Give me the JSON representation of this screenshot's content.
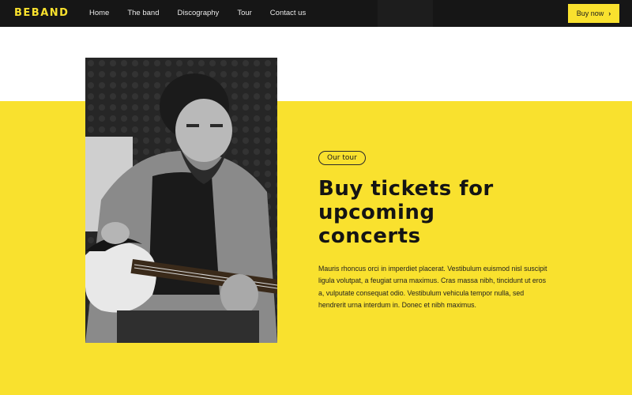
{
  "brand": {
    "logo": "BEBAND"
  },
  "nav": {
    "items": [
      {
        "label": "Home"
      },
      {
        "label": "The band"
      },
      {
        "label": "Discography"
      },
      {
        "label": "Tour"
      },
      {
        "label": "Contact us"
      }
    ],
    "cta_label": "Buy now",
    "cta_icon": "chevron-right-icon"
  },
  "hero": {
    "image_alt": "",
    "tag": "Our tour",
    "heading_line1": "Buy tickets for",
    "heading_line2": "upcoming",
    "heading_line3": "concerts",
    "body": "Mauris rhoncus orci in imperdiet placerat. Vestibulum euismod nisl suscipit ligula volutpat, a feugiat urna maximus. Cras massa nibh, tincidunt ut eros a, vulputate consequat odio. Vestibulum vehicula tempor nulla, sed hendrerit urna interdum in. Donec et nibh maximus."
  },
  "colors": {
    "accent": "#f9e12e",
    "nav_bg": "#161616",
    "text_dark": "#141414"
  }
}
